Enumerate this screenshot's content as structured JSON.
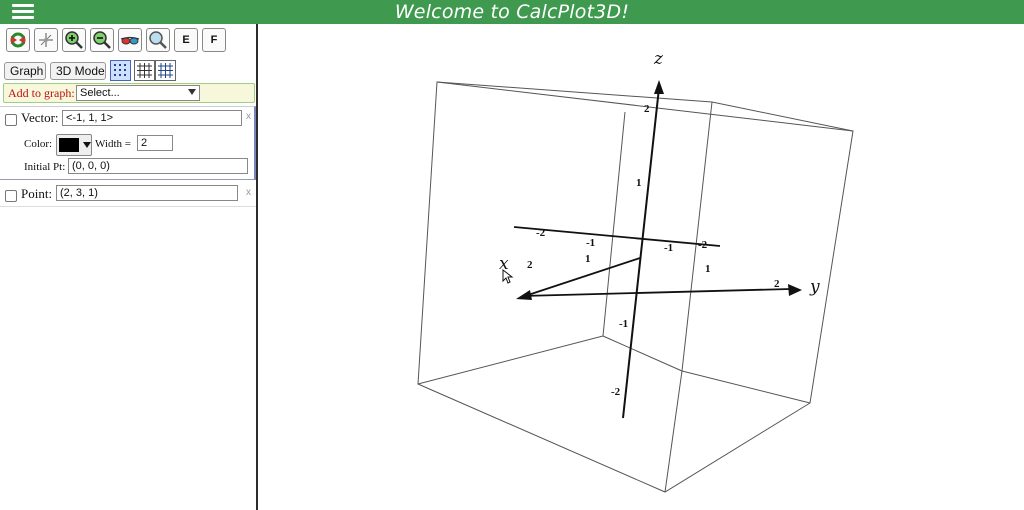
{
  "header": {
    "title": "Welcome to CalcPlot3D!",
    "menu_icon": "hamburger-icon"
  },
  "toolbar": {
    "icons": [
      "reset-rotate-icon",
      "axes-settings-icon",
      "zoom-in-icon",
      "zoom-out-icon",
      "3d-glasses-icon",
      "zoom-fit-icon"
    ],
    "e_label": "E",
    "f_label": "F"
  },
  "buttons": {
    "graph": "Graph",
    "mode": "3D Mode"
  },
  "add_to_graph": {
    "label": "Add to graph:",
    "selected": "Select..."
  },
  "vector": {
    "label": "Vector:",
    "value": "<-1, 1, 1>",
    "color_label": "Color:",
    "color": "#000000",
    "width_label": "Width =",
    "width_value": "2",
    "initial_label": "Initial Pt:",
    "initial_value": "(0, 0, 0)",
    "close": "x"
  },
  "point": {
    "label": "Point:",
    "value": "(2, 3, 1)",
    "close": "x"
  },
  "plot": {
    "axis_labels": {
      "x": "x",
      "y": "y",
      "z": "z"
    },
    "z_ticks": [
      "2",
      "1",
      "-1",
      "-2"
    ],
    "x_ticks": [
      "-2",
      "-1",
      "1",
      "2"
    ],
    "x_neg_ticks": [
      "-2",
      "-1"
    ],
    "y_ticks": [
      "-1",
      "-2",
      "1",
      "2"
    ]
  }
}
